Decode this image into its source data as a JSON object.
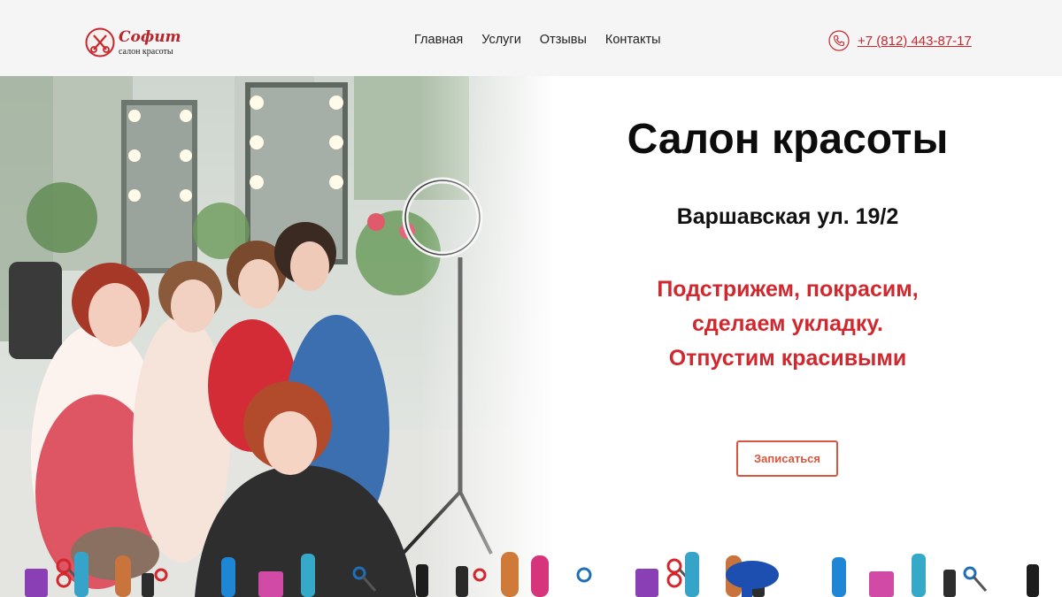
{
  "header": {
    "logo": {
      "name": "Софит",
      "subtitle": "салон красоты"
    },
    "nav": [
      {
        "label": "Главная"
      },
      {
        "label": "Услуги"
      },
      {
        "label": "Отзывы"
      },
      {
        "label": "Контакты"
      }
    ],
    "phone": {
      "icon": "phone-icon",
      "number": "+7 (812) 443-87-17"
    }
  },
  "hero": {
    "title": "Салон красоты",
    "address": "Варшавская ул. 19/2",
    "tagline": [
      "Подстрижем, покрасим,",
      "сделаем укладку.",
      "Отпустим красивыми"
    ],
    "button_label": "Записаться"
  },
  "colors": {
    "brand_red": "#c9262d",
    "accent_orange": "#d9553d",
    "header_bg": "#f5f5f5"
  }
}
